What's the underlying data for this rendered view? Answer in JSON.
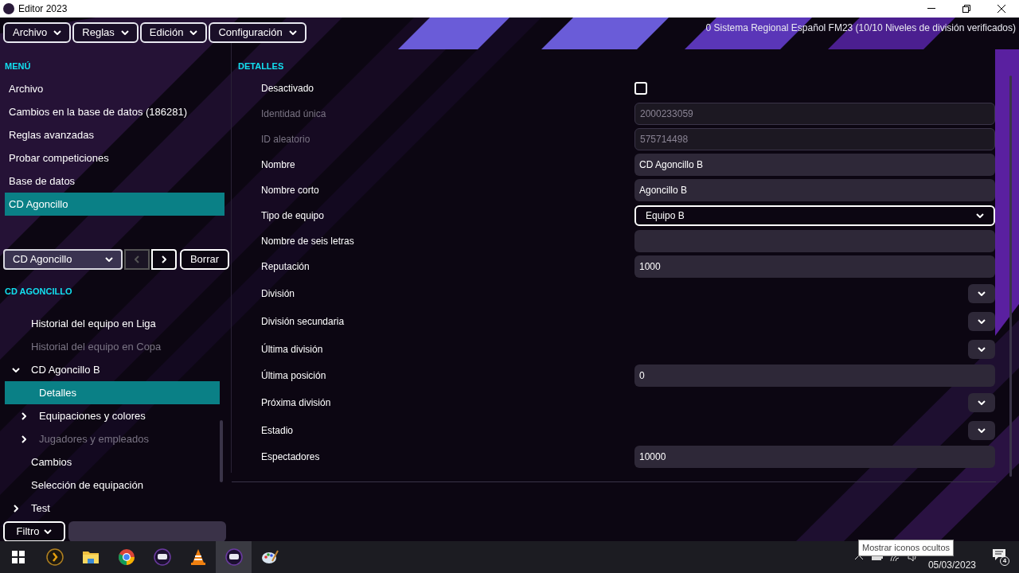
{
  "window": {
    "title": "Editor 2023"
  },
  "menu_bar": [
    {
      "label": "Archivo"
    },
    {
      "label": "Reglas"
    },
    {
      "label": "Edición"
    },
    {
      "label": "Configuración"
    }
  ],
  "status_text": "0 Sistema Regional Español FM23 (10/10 Niveles de división verificados)",
  "menu": {
    "heading": "MENÚ",
    "items": [
      {
        "label": "Archivo",
        "selected": false
      },
      {
        "label": "Cambios en la base de datos (186281)",
        "selected": false
      },
      {
        "label": "Reglas avanzadas",
        "selected": false
      },
      {
        "label": "Probar competiciones",
        "selected": false
      },
      {
        "label": "Base de datos",
        "selected": false
      },
      {
        "label": "CD Agoncillo",
        "selected": true
      }
    ]
  },
  "navigator": {
    "dropdown": "CD Agoncillo",
    "prev_disabled": true,
    "next_disabled": false,
    "clear_button": "Borrar"
  },
  "tree": {
    "heading": "CD AGONCILLO",
    "items": [
      {
        "label": "Historial del equipo en Liga",
        "disabled": false,
        "selected": false
      },
      {
        "label": "Historial del equipo en Copa",
        "disabled": true,
        "selected": false
      },
      {
        "label": "CD Agoncillo B",
        "expanded": true,
        "disabled": false,
        "selected": false,
        "children": [
          {
            "label": "Detalles",
            "disabled": false,
            "selected": true
          },
          {
            "label": "Equipaciones y colores",
            "expanded": false,
            "disabled": false,
            "selected": false
          },
          {
            "label": "Jugadores y empleados",
            "expanded": false,
            "disabled": true,
            "selected": false
          }
        ]
      },
      {
        "label": "Cambios",
        "disabled": false,
        "selected": false
      },
      {
        "label": "Selección de equipación",
        "disabled": false,
        "selected": false
      },
      {
        "label": "Test",
        "expanded": false,
        "disabled": false,
        "selected": false
      }
    ]
  },
  "filter": {
    "button": "Filtro"
  },
  "details": {
    "heading": "DETALLES",
    "fields": [
      {
        "label": "Desactivado",
        "kind": "checkbox",
        "checked": false
      },
      {
        "label": "Identidad única",
        "kind": "text",
        "value": "2000233059",
        "disabled": true
      },
      {
        "label": "ID aleatorio",
        "kind": "text",
        "value": "575714498",
        "disabled": true
      },
      {
        "label": "Nombre",
        "kind": "text",
        "value": "CD Agoncillo B",
        "disabled": false
      },
      {
        "label": "Nombre corto",
        "kind": "text",
        "value": "Agoncillo B",
        "disabled": false
      },
      {
        "label": "Tipo de equipo",
        "kind": "select",
        "value": "Equipo B"
      },
      {
        "label": "Nombre de seis letras",
        "kind": "text",
        "disabled": false
      },
      {
        "label": "Reputación",
        "kind": "text",
        "value": "1000",
        "disabled": false
      },
      {
        "label": "División",
        "kind": "picker"
      },
      {
        "label": "División secundaria",
        "kind": "picker"
      },
      {
        "label": "Última división",
        "kind": "picker"
      },
      {
        "label": "Última posición",
        "kind": "text",
        "value": "0",
        "disabled": false
      },
      {
        "label": "Próxima división",
        "kind": "picker"
      },
      {
        "label": "Estadio",
        "kind": "picker"
      },
      {
        "label": "Espectadores",
        "kind": "text",
        "value": "10000",
        "disabled": false
      }
    ]
  },
  "taskbar": {
    "apps": [
      {
        "kind": "start",
        "active": false
      },
      {
        "kind": "plex",
        "active": false
      },
      {
        "kind": "folder",
        "active": false
      },
      {
        "kind": "chrome",
        "active": false
      },
      {
        "kind": "fm",
        "active": false
      },
      {
        "kind": "vlc",
        "active": false
      },
      {
        "kind": "fm",
        "active": true
      },
      {
        "kind": "paint",
        "active": false
      }
    ],
    "tooltip": "Mostrar iconos ocultos",
    "date": "05/03/2023",
    "notifications": "4"
  }
}
